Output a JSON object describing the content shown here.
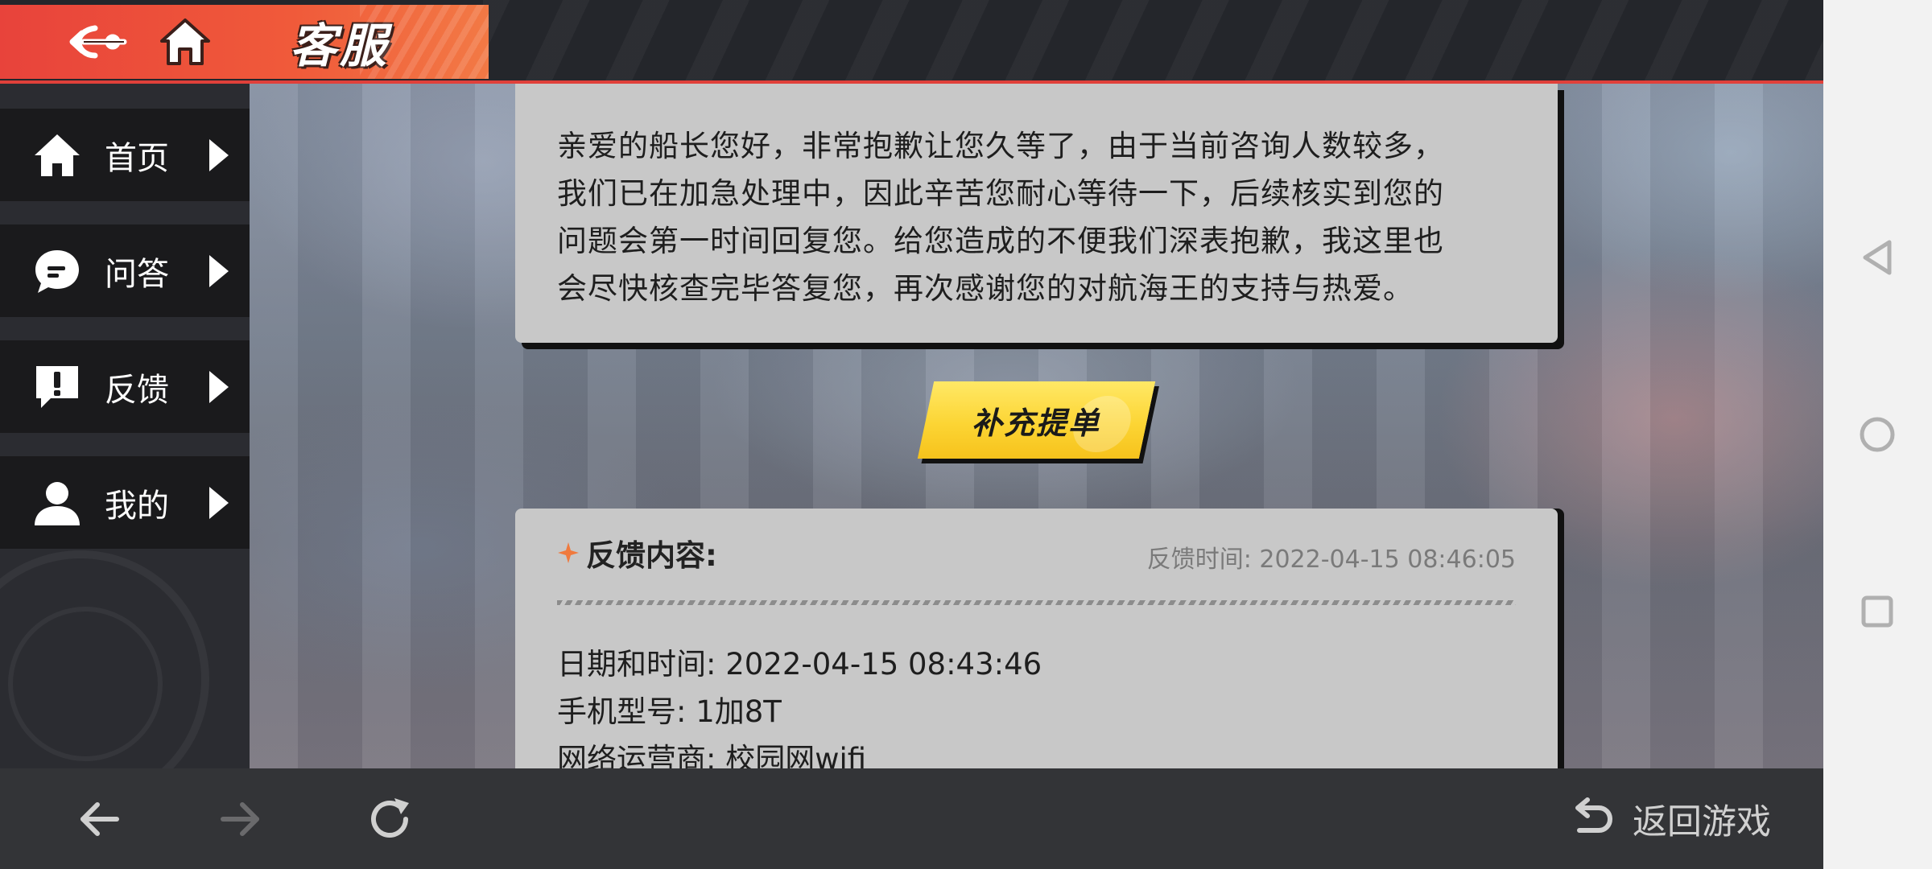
{
  "header": {
    "title": "客服",
    "back_icon": "anchor-back-icon",
    "home_icon": "home-icon"
  },
  "sidebar": {
    "items": [
      {
        "label": "首页",
        "icon": "home-icon"
      },
      {
        "label": "问答",
        "icon": "chat-bubble-icon"
      },
      {
        "label": "反馈",
        "icon": "exclamation-bubble-icon"
      },
      {
        "label": "我的",
        "icon": "user-icon"
      }
    ]
  },
  "message": {
    "lines": [
      "亲爱的船长您好，非常抱歉让您久等了，由于当前咨询人数较多，",
      "我们已在加急处理中，因此辛苦您耐心等待一下，后续核实到您的",
      "问题会第一时间回复您。给您造成的不便我们深表抱歉，我这里也",
      "会尽快核查完毕答复您，再次感谢您的对航海王的支持与热爱。"
    ]
  },
  "supplement_button": {
    "label": "补充提单"
  },
  "feedback": {
    "title": "反馈内容:",
    "time": "反馈时间: 2022-04-15 08:46:05",
    "lines": [
      "日期和时间: 2022-04-15 08:43:46",
      "手机型号: 1加8T",
      "网络运营商: 校园网wifi"
    ]
  },
  "bottombar": {
    "return_label": "返回游戏"
  },
  "colors": {
    "accent_red": "#e8433b",
    "button_yellow": "#fcd534",
    "card_gray": "#c8c8c8",
    "sidebar_dark": "#1a1a1c"
  }
}
